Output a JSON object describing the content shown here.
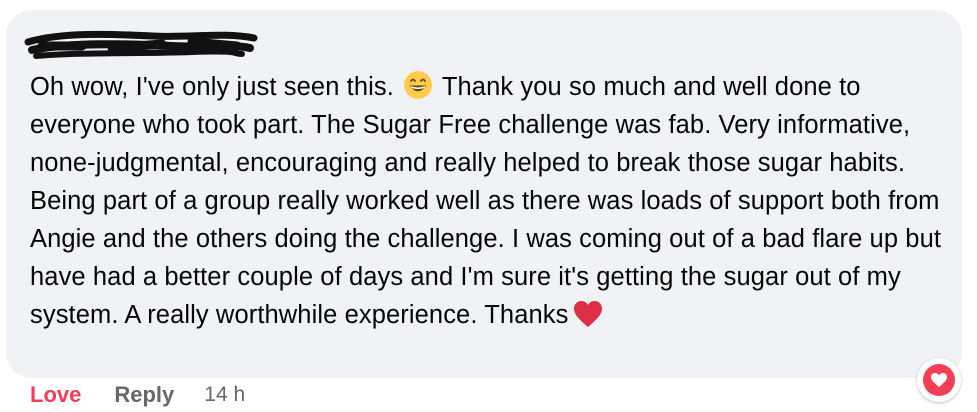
{
  "comment": {
    "text_part1": "Oh wow, I've only just seen this.",
    "text_part2": " Thank you so much and well done to everyone who took part. The Sugar Free challenge was fab. Very informative, none-judgmental, encouraging and really helped to break those sugar habits. Being part of a group really worked well as there was loads of support both from Angie and the others doing the challenge. I was coming out of a bad flare up but have had a better couple of days and I'm sure it's getting the sugar out of my system. A really worthwhile experience. Thanks",
    "emoji_1": "grinning-smiling-eyes-emoji",
    "emoji_2": "red-heart-emoji",
    "author_redacted": true
  },
  "actions": {
    "love_label": "Love",
    "reply_label": "Reply",
    "timestamp": "14 h"
  },
  "reaction": {
    "type": "love",
    "icon": "heart-icon"
  },
  "colors": {
    "bubble_bg": "#f0f2f5",
    "text": "#050505",
    "love": "#f33e58",
    "secondary": "#65676b"
  }
}
